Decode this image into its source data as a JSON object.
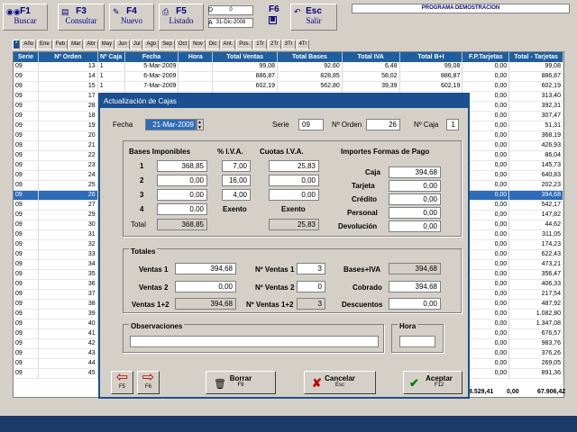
{
  "toolbar": {
    "buscar": {
      "key": "F1",
      "label": "Buscar"
    },
    "consultar": {
      "key": "F3",
      "label": "Consultar"
    },
    "nuevo": {
      "key": "F4",
      "label": "Nuevo"
    },
    "listado": {
      "key": "F5",
      "label": "Listado"
    },
    "f6": "F6",
    "salir": {
      "key": "Esc",
      "label": "Salir"
    },
    "date_from_label": "D",
    "date_from": "0",
    "date_to_label": "A",
    "date_to": "31-Dic-2008",
    "program_title": "PROGRAMA DEMOSTRACION"
  },
  "tabs": [
    "*",
    "Año",
    "Ene",
    "Feb",
    "Mar",
    "Abr",
    "May",
    "Jun",
    "Jul",
    "Ago",
    "Sep",
    "Oct",
    "Nov",
    "Dic",
    "Ant.",
    "Pos.",
    "1Tr",
    "2Tr",
    "3Tr",
    "4Tr"
  ],
  "grid": {
    "headers": [
      "Serie",
      "Nº Orden",
      "Nº Caja",
      "Fecha",
      "Hora",
      "Total Ventas",
      "Total Bases",
      "Total IVA",
      "Total B+I",
      "F.P.Tarjetas",
      "Total - Tarjetas"
    ],
    "rows": [
      [
        "09",
        "13",
        "1",
        "5-Mar-2009",
        "",
        "99,08",
        "92,60",
        "6,48",
        "99,08",
        "0,00",
        "99,08"
      ],
      [
        "09",
        "14",
        "1",
        "6-Mar-2009",
        "",
        "886,87",
        "828,85",
        "58,02",
        "886,87",
        "0,00",
        "886,87"
      ],
      [
        "09",
        "15",
        "1",
        "7-Mar-2009",
        "",
        "602,19",
        "562,80",
        "39,39",
        "602,19",
        "0,00",
        "602,19"
      ],
      [
        "09",
        "17",
        "",
        "",
        "",
        "",
        "",
        "",
        "",
        "0,00",
        "313,40"
      ],
      [
        "09",
        "28",
        "",
        "",
        "",
        "",
        "",
        "",
        "",
        "0,00",
        "392,31"
      ],
      [
        "09",
        "18",
        "",
        "",
        "",
        "",
        "",
        "",
        "",
        "0,00",
        "307,47"
      ],
      [
        "09",
        "19",
        "",
        "",
        "",
        "",
        "",
        "",
        "",
        "0,00",
        "51,31"
      ],
      [
        "09",
        "20",
        "",
        "",
        "",
        "",
        "",
        "",
        "",
        "0,00",
        "368,19"
      ],
      [
        "09",
        "21",
        "",
        "",
        "",
        "",
        "",
        "",
        "",
        "0,00",
        "426,93"
      ],
      [
        "09",
        "22",
        "",
        "",
        "",
        "",
        "",
        "",
        "",
        "0,00",
        "86,04"
      ],
      [
        "09",
        "23",
        "",
        "",
        "",
        "",
        "",
        "",
        "",
        "0,00",
        "145,73"
      ],
      [
        "09",
        "24",
        "",
        "",
        "",
        "",
        "",
        "",
        "",
        "0,00",
        "640,83"
      ],
      [
        "09",
        "25",
        "",
        "",
        "",
        "",
        "",
        "",
        "",
        "0,00",
        "202,23"
      ],
      [
        "09",
        "26",
        "",
        "",
        "",
        "",
        "",
        "",
        "",
        "0,00",
        "394,68"
      ],
      [
        "09",
        "27",
        "",
        "",
        "",
        "",
        "",
        "",
        "",
        "0,00",
        "542,17"
      ],
      [
        "09",
        "29",
        "",
        "",
        "",
        "",
        "",
        "",
        "",
        "0,00",
        "147,82"
      ],
      [
        "09",
        "30",
        "",
        "",
        "",
        "",
        "",
        "",
        "",
        "0,00",
        "44,62"
      ],
      [
        "09",
        "31",
        "",
        "",
        "",
        "",
        "",
        "",
        "",
        "0,00",
        "311,05"
      ],
      [
        "09",
        "32",
        "",
        "",
        "",
        "",
        "",
        "",
        "",
        "0,00",
        "174,23"
      ],
      [
        "09",
        "33",
        "",
        "",
        "",
        "",
        "",
        "",
        "",
        "0,00",
        "622,43"
      ],
      [
        "09",
        "34",
        "",
        "",
        "",
        "",
        "",
        "",
        "",
        "0,00",
        "473,21"
      ],
      [
        "09",
        "35",
        "",
        "",
        "",
        "",
        "",
        "",
        "",
        "0,00",
        "356,47"
      ],
      [
        "09",
        "36",
        "",
        "",
        "",
        "",
        "",
        "",
        "",
        "0,00",
        "406,33"
      ],
      [
        "09",
        "37",
        "",
        "",
        "",
        "",
        "",
        "",
        "",
        "0,00",
        "217,54"
      ],
      [
        "09",
        "38",
        "",
        "",
        "",
        "",
        "",
        "",
        "",
        "0,00",
        "487,92"
      ],
      [
        "09",
        "39",
        "",
        "",
        "",
        "",
        "",
        "",
        "",
        "0,00",
        "1.082,80"
      ],
      [
        "09",
        "40",
        "",
        "",
        "",
        "",
        "",
        "",
        "",
        "0,00",
        "1.347,08"
      ],
      [
        "09",
        "41",
        "",
        "",
        "",
        "",
        "",
        "",
        "",
        "0,00",
        "676,57"
      ],
      [
        "09",
        "42",
        "",
        "",
        "",
        "",
        "",
        "",
        "",
        "0,00",
        "983,76"
      ],
      [
        "09",
        "43",
        "",
        "",
        "",
        "",
        "",
        "",
        "",
        "0,00",
        "376,26"
      ],
      [
        "09",
        "44",
        "",
        "",
        "",
        "",
        "",
        "",
        "",
        "0,00",
        "269,05"
      ],
      [
        "09",
        "45",
        "",
        "",
        "",
        "",
        "",
        "",
        "",
        "0,00",
        "891,36"
      ]
    ],
    "selected_row": 13,
    "total_bi": "8.529,41",
    "total_fp": "0,00",
    "total_total": "67.906,42"
  },
  "dialog": {
    "title": "Actualización de Cajas",
    "fecha_label": "Fecha",
    "fecha": "21-Mar-2009",
    "serie_label": "Serie",
    "serie": "09",
    "orden_label": "Nº Orden",
    "orden": "26",
    "caja_label": "Nº Caja",
    "caja": "1",
    "bases_title": "Bases Imponibles",
    "iva_title": "% I.V.A.",
    "cuotas_title": "Cuotas I.V.A.",
    "lines": [
      {
        "n": "1",
        "base": "368,85",
        "iva": "7,00",
        "cuota": "25,83"
      },
      {
        "n": "2",
        "base": "0,00",
        "iva": "16,00",
        "cuota": "0,00"
      },
      {
        "n": "3",
        "base": "0,00",
        "iva": "4,00",
        "cuota": "0,00"
      },
      {
        "n": "4",
        "base": "0,00",
        "iva": "Exento",
        "cuota": "Exento"
      }
    ],
    "total_label": "Total",
    "total_base": "368,85",
    "total_cuota": "25,83",
    "pago_title": "Importes Formas de Pago",
    "pago": [
      {
        "label": "Caja",
        "value": "394,68"
      },
      {
        "label": "Tarjeta",
        "value": "0,00"
      },
      {
        "label": "Crédito",
        "value": "0,00"
      },
      {
        "label": "Personal",
        "value": "0,00"
      },
      {
        "label": "Devolución",
        "value": "0,00"
      }
    ],
    "totales_title": "Totales",
    "ventas1_label": "Ventas 1",
    "ventas1": "394,68",
    "ventas2_label": "Ventas 2",
    "ventas2": "0,00",
    "ventas12_label": "Ventas 1+2",
    "ventas12": "394,68",
    "nventas1_label": "Nº Ventas 1",
    "nventas1": "3",
    "nventas2_label": "Nº Ventas 2",
    "nventas2": "0",
    "nventas12_label": "Nº Ventas 1+2",
    "nventas12": "3",
    "basesiva_label": "Bases+IVA",
    "basesiva": "394,68",
    "cobrado_label": "Cobrado",
    "cobrado": "394,68",
    "descuentos_label": "Descuentos",
    "descuentos": "0,00",
    "obs_label": "Observaciones",
    "obs": "",
    "hora_label": "Hora",
    "hora": "",
    "btn_prev": "F5",
    "btn_next": "F6",
    "borrar": {
      "label": "Borrar",
      "key": "F9"
    },
    "cancelar": {
      "label": "Cancelar",
      "key": "Esc"
    },
    "aceptar": {
      "label": "Aceptar",
      "key": "F12"
    }
  }
}
